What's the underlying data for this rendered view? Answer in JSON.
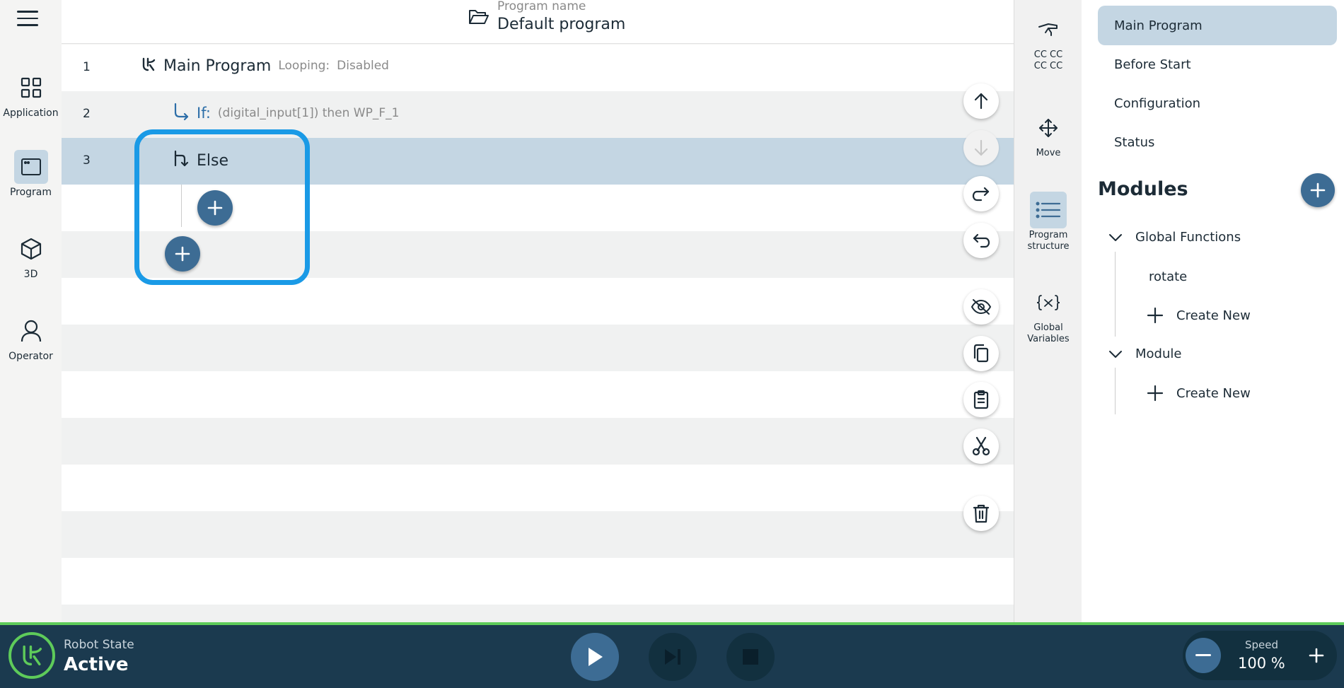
{
  "nav": {
    "items": [
      {
        "label": "Application",
        "icon": "grid-icon"
      },
      {
        "label": "Program",
        "icon": "program-window-icon"
      },
      {
        "label": "3D",
        "icon": "cube-icon"
      },
      {
        "label": "Operator",
        "icon": "person-icon"
      }
    ],
    "active": "Program"
  },
  "header": {
    "program_label": "Program name",
    "program_name": "Default program"
  },
  "program_tree": {
    "rows": [
      {
        "line": "1",
        "title": "Main Program",
        "meta_label": "Looping:",
        "meta_value": "Disabled"
      },
      {
        "line": "2",
        "keyword": "If:",
        "condition": "(digital_input[1]) then WP_F_1"
      },
      {
        "line": "3",
        "title": "Else",
        "selected": true
      }
    ]
  },
  "sidebar2": {
    "items": [
      {
        "label_line1": "CC CC",
        "label_line2": "CC CC",
        "icon": "gripper-icon"
      },
      {
        "label_line1": "Move",
        "label_line2": "",
        "icon": "move-arrows-icon"
      },
      {
        "label_line1": "Program",
        "label_line2": "structure",
        "icon": "list-icon"
      },
      {
        "label_line1": "Global",
        "label_line2": "Variables",
        "icon": "variable-icon"
      }
    ]
  },
  "right_panel": {
    "items": [
      "Main Program",
      "Before Start",
      "Configuration",
      "Status"
    ],
    "modules_title": "Modules",
    "groups": [
      {
        "name": "Global Functions",
        "children": [
          "rotate"
        ],
        "create_label": "Create New"
      },
      {
        "name": "Module",
        "children": [],
        "create_label": "Create New"
      }
    ]
  },
  "bottom": {
    "robot_state_label": "Robot State",
    "robot_state_value": "Active",
    "speed_label": "Speed",
    "speed_value": "100 %"
  },
  "colors": {
    "accent": "#3d6c94",
    "selection": "#c4d6e3",
    "highlight": "#1a9ae6",
    "status_green": "#5ecb5a",
    "bottom_bar": "#1b3a4f"
  }
}
